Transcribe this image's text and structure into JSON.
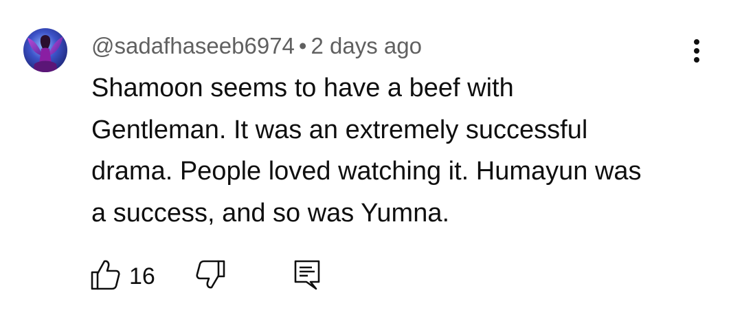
{
  "comment": {
    "author_handle": "@sadafhaseeb6974",
    "separator": "•",
    "timestamp": "2 days ago",
    "text": "Shamoon seems to have a beef with Gentleman. It was an extremely successful drama. People loved watching it. Humayun was a success, and so was Yumna.",
    "like_count": "16",
    "icons": {
      "avatar": "avatar-image",
      "more": "more-vert-icon",
      "like": "thumb-up-icon",
      "dislike": "thumb-down-icon",
      "reply": "reply-comment-icon"
    },
    "colors": {
      "text": "#0f0f0f",
      "meta": "#606060"
    }
  }
}
